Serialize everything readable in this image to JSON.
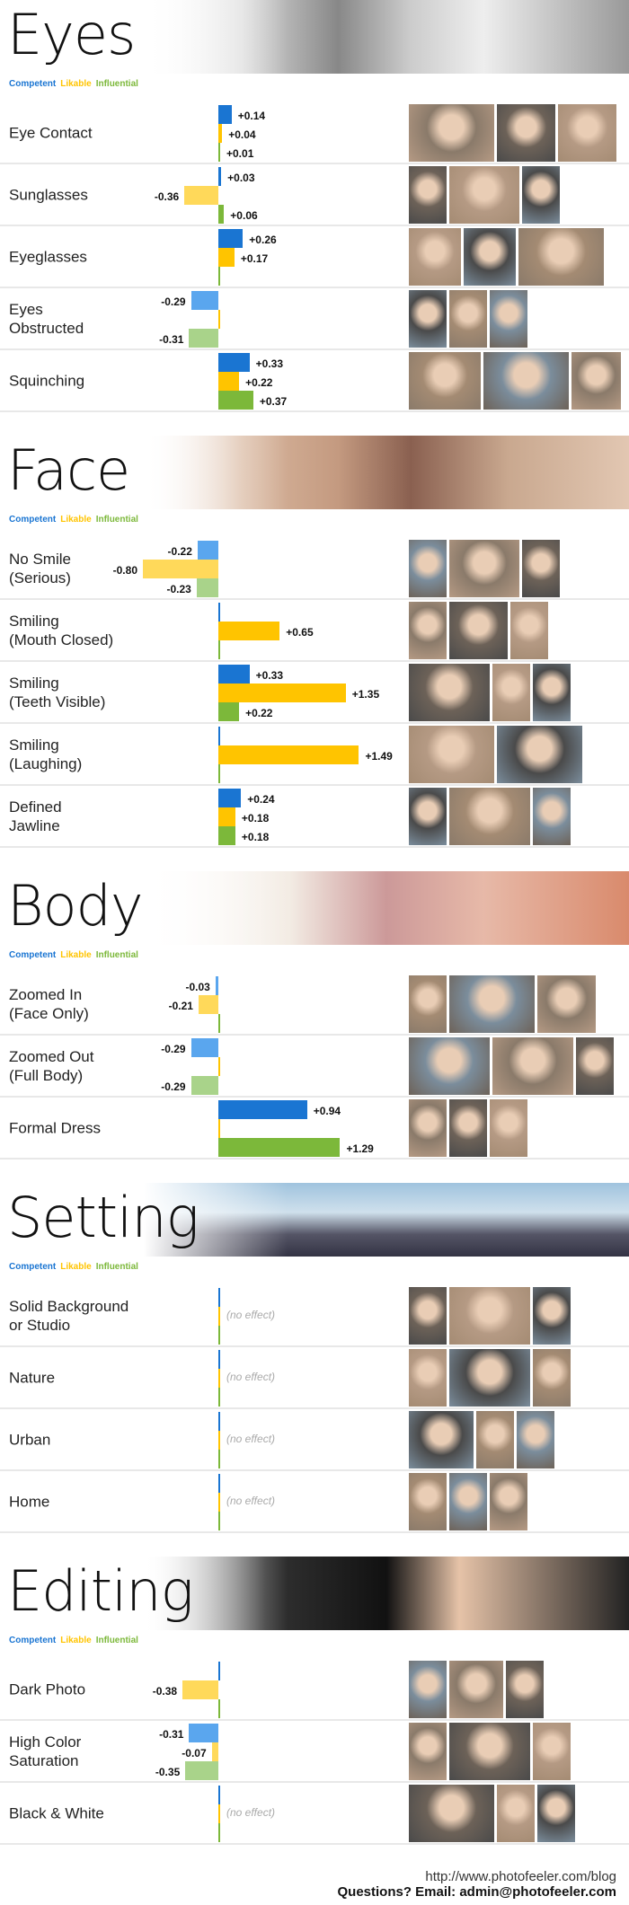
{
  "legend": {
    "competent": "Competent",
    "likable": "Likable",
    "influential": "Influential"
  },
  "colors": {
    "competent": "#1a75d2",
    "likable": "#ffc400",
    "influential": "#7cb83a",
    "competent_neg": "#5aa6ee",
    "likable_neg": "#ffd95a",
    "influential_neg": "#a9d38a"
  },
  "no_effect_text": "(no effect)",
  "chart_data": {
    "type": "bar",
    "orientation": "horizontal",
    "series_names": [
      "Competent",
      "Likable",
      "Influential"
    ],
    "sections": [
      {
        "title": "Eyes",
        "rows": [
          {
            "label": "Eye Contact",
            "values": [
              0.14,
              0.04,
              0.01
            ],
            "value_labels": [
              "+0.14",
              "+0.04",
              "+0.01"
            ]
          },
          {
            "label": "Sunglasses",
            "values": [
              0.03,
              -0.36,
              0.06
            ],
            "value_labels": [
              "+0.03",
              "-0.36",
              "+0.06"
            ]
          },
          {
            "label": "Eyeglasses",
            "values": [
              0.26,
              0.17,
              0
            ],
            "value_labels": [
              "+0.26",
              "+0.17",
              null
            ]
          },
          {
            "label": "Eyes\nObstructed",
            "values": [
              -0.29,
              0,
              -0.31
            ],
            "value_labels": [
              "-0.29",
              null,
              "-0.31"
            ]
          },
          {
            "label": "Squinching",
            "values": [
              0.33,
              0.22,
              0.37
            ],
            "value_labels": [
              "+0.33",
              "+0.22",
              "+0.37"
            ]
          }
        ]
      },
      {
        "title": "Face",
        "rows": [
          {
            "label": "No Smile\n(Serious)",
            "values": [
              -0.22,
              -0.8,
              -0.23
            ],
            "value_labels": [
              "-0.22",
              "-0.80",
              "-0.23"
            ]
          },
          {
            "label": "Smiling\n(Mouth Closed)",
            "values": [
              0,
              0.65,
              0
            ],
            "value_labels": [
              null,
              "+0.65",
              null
            ]
          },
          {
            "label": "Smiling\n(Teeth Visible)",
            "values": [
              0.33,
              1.35,
              0.22
            ],
            "value_labels": [
              "+0.33",
              "+1.35",
              "+0.22"
            ]
          },
          {
            "label": "Smiling\n(Laughing)",
            "values": [
              0,
              1.49,
              0
            ],
            "value_labels": [
              null,
              "+1.49",
              null
            ]
          },
          {
            "label": "Defined\nJawline",
            "values": [
              0.24,
              0.18,
              0.18
            ],
            "value_labels": [
              "+0.24",
              "+0.18",
              "+0.18"
            ]
          }
        ]
      },
      {
        "title": "Body",
        "rows": [
          {
            "label": "Zoomed In\n(Face Only)",
            "values": [
              -0.03,
              -0.21,
              0
            ],
            "value_labels": [
              "-0.03",
              "-0.21",
              null
            ]
          },
          {
            "label": "Zoomed Out\n(Full Body)",
            "values": [
              -0.29,
              0,
              -0.29
            ],
            "value_labels": [
              "-0.29",
              null,
              "-0.29"
            ]
          },
          {
            "label": "Formal Dress",
            "values": [
              0.94,
              0,
              1.29
            ],
            "value_labels": [
              "+0.94",
              null,
              "+1.29"
            ]
          }
        ]
      },
      {
        "title": "Setting",
        "rows": [
          {
            "label": "Solid Background\nor Studio",
            "values": [
              0,
              0,
              0
            ],
            "value_labels": [
              null,
              null,
              null
            ],
            "no_effect": true
          },
          {
            "label": "Nature",
            "values": [
              0,
              0,
              0
            ],
            "value_labels": [
              null,
              null,
              null
            ],
            "no_effect": true
          },
          {
            "label": "Urban",
            "values": [
              0,
              0,
              0
            ],
            "value_labels": [
              null,
              null,
              null
            ],
            "no_effect": true
          },
          {
            "label": "Home",
            "values": [
              0,
              0,
              0
            ],
            "value_labels": [
              null,
              null,
              null
            ],
            "no_effect": true
          }
        ]
      },
      {
        "title": "Editing",
        "rows": [
          {
            "label": "Dark Photo",
            "values": [
              0,
              -0.38,
              0
            ],
            "value_labels": [
              null,
              "-0.38",
              null
            ]
          },
          {
            "label": "High Color\nSaturation",
            "values": [
              -0.31,
              -0.07,
              -0.35
            ],
            "value_labels": [
              "-0.31",
              "-0.07",
              "-0.35"
            ]
          },
          {
            "label": "Black & White",
            "values": [
              0,
              0,
              0
            ],
            "value_labels": [
              null,
              null,
              null
            ],
            "no_effect": true
          }
        ]
      }
    ]
  },
  "footer": {
    "url": "http://www.photofeeler.com/blog",
    "email": "Questions? Email: admin@photofeeler.com"
  }
}
